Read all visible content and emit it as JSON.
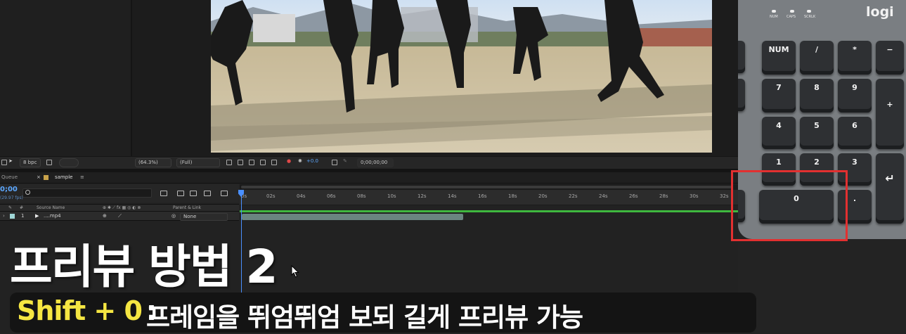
{
  "toolbar": {
    "bpc": "8 bpc",
    "zoom": "(64.3%)",
    "resolution": "(Full)",
    "exposure": "+0.0",
    "timecode": "0;00;00;00"
  },
  "panel_tabs": {
    "queue": "Queue",
    "comp": "sample"
  },
  "timeline": {
    "current_time": "0;00",
    "fps": "(29.97 fps)",
    "search_placeholder": "",
    "columns": {
      "source_name": "Source Name",
      "parent_link": "Parent & Link"
    },
    "layer": {
      "index": "1",
      "name": "....mp4",
      "parent": "None"
    },
    "ruler_ticks": [
      "0s",
      "02s",
      "04s",
      "06s",
      "08s",
      "10s",
      "12s",
      "14s",
      "16s",
      "18s",
      "20s",
      "22s",
      "24s",
      "26s",
      "28s",
      "30s",
      "32s"
    ]
  },
  "keyboard": {
    "logo": "logi",
    "leds": [
      "NUM",
      "CAPS",
      "SCRLK"
    ],
    "keys": [
      "NUM",
      "/",
      "*",
      "−",
      "7",
      "8",
      "9",
      "+",
      "4",
      "5",
      "6",
      "1",
      "2",
      "3",
      "↵",
      "0",
      "."
    ]
  },
  "overlay": {
    "title": "프리뷰 방법 2",
    "shortcut": "Shift + 0",
    "colon": ":",
    "description": "프레임을 뛰엄뛰엄 보되 길게 프리뷰 가능"
  },
  "colors": {
    "highlight": "#e23030",
    "shortcut": "#f5e642",
    "playhead": "#4a8fff",
    "work_area": "#3fb83f"
  }
}
